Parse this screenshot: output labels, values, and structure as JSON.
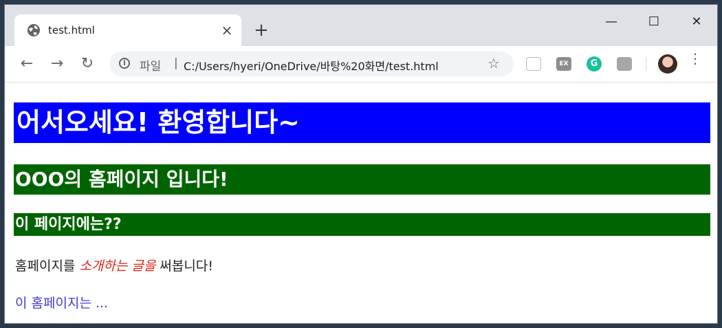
{
  "browser": {
    "tab_title": "test.html",
    "tab_close": "×",
    "new_tab": "+",
    "window_controls": {
      "minimize": "—",
      "maximize": "☐",
      "close": "✕"
    },
    "nav": {
      "back": "←",
      "forward": "→",
      "reload": "↻"
    },
    "omnibox": {
      "scheme_label": "파일",
      "separator": "|",
      "url": "C:/Users/hyeri/OneDrive/바탕%20화면/test.html"
    },
    "bookmark_star": "☆",
    "extensions": [
      {
        "icon": "pocket-icon",
        "label": ""
      },
      {
        "icon": "ex-extension-icon",
        "label": "EX"
      },
      {
        "icon": "grammarly-icon",
        "label": "G"
      },
      {
        "icon": "pdf-icon",
        "label": ""
      }
    ],
    "menu": "⋮"
  },
  "page": {
    "h1": "어서오세요! 환영합니다~",
    "h2": "OOO의 홈페이지 입니다!",
    "h3": "이 페이지에는??",
    "paragraph": {
      "before": "홈페이지를 ",
      "emphasis": "소개하는 글을",
      "after": " 써봅니다!"
    },
    "colored_text": "이 홈페이지는 ..."
  },
  "colors": {
    "h1_background": "#0000ff",
    "h2_background": "#006400",
    "h3_background": "#006400",
    "emphasis_text": "#e0241a",
    "colored_text": "#3b3bd6"
  }
}
